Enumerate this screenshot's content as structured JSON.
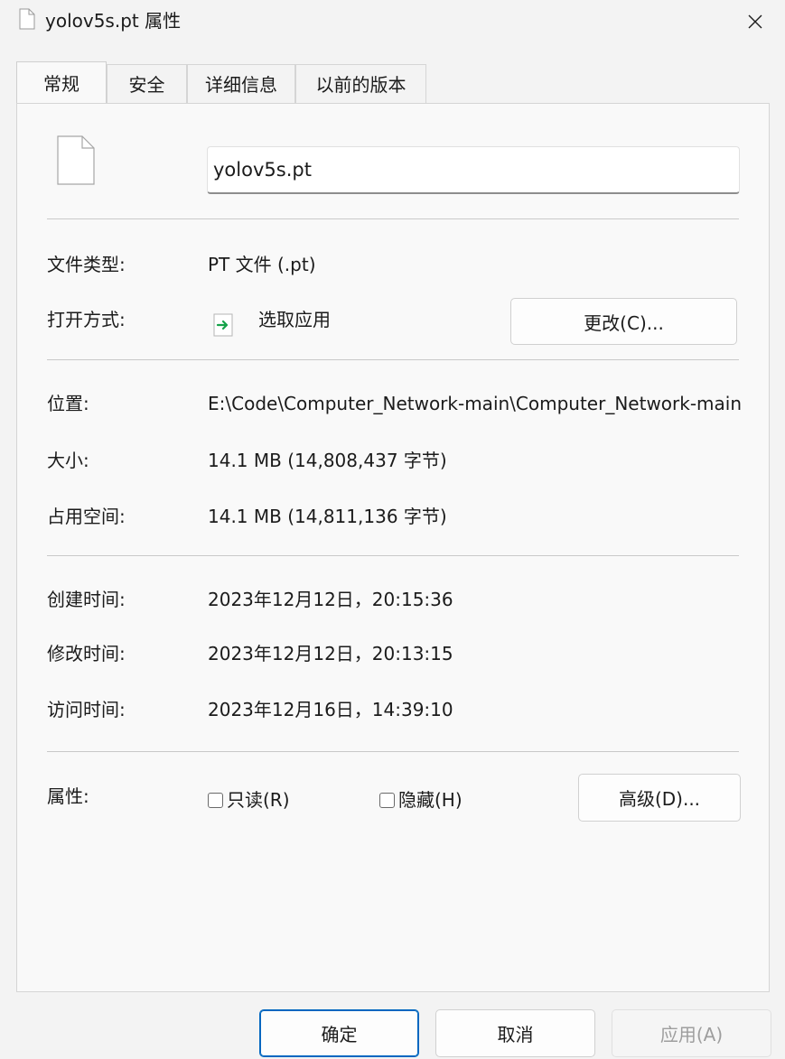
{
  "window": {
    "title": "yolov5s.pt 属性",
    "close_glyph": "✕"
  },
  "tabs": [
    {
      "label": "常规",
      "active": true
    },
    {
      "label": "安全",
      "active": false
    },
    {
      "label": "详细信息",
      "active": false
    },
    {
      "label": "以前的版本",
      "active": false
    }
  ],
  "general": {
    "file_name": "yolov5s.pt",
    "file_type_label": "文件类型:",
    "file_type_value": "PT 文件 (.pt)",
    "open_with_label": "打开方式:",
    "open_with_value": "选取应用",
    "change_button": "更改(C)...",
    "location_label": "位置:",
    "location_value": "E:\\Code\\Computer_Network-main\\Computer_Network-main",
    "size_label": "大小:",
    "size_value": "14.1 MB (14,808,437 字节)",
    "size_on_disk_label": "占用空间:",
    "size_on_disk_value": "14.1 MB (14,811,136 字节)",
    "created_label": "创建时间:",
    "created_value": "2023年12月12日，20:15:36",
    "modified_label": "修改时间:",
    "modified_value": "2023年12月12日，20:13:15",
    "accessed_label": "访问时间:",
    "accessed_value": "2023年12月16日，14:39:10",
    "attributes_label": "属性:",
    "readonly_label": "只读(R)",
    "readonly_checked": false,
    "hidden_label": "隐藏(H)",
    "hidden_checked": false,
    "advanced_button": "高级(D)..."
  },
  "footer": {
    "ok_button": "确定",
    "cancel_button": "取消",
    "apply_button": "应用(A)"
  },
  "icons": {
    "title": "file-icon",
    "close": "close-icon",
    "big_file": "file-icon",
    "app": "pick-app-icon"
  },
  "colors": {
    "accent": "#0067c0",
    "app_icon_arrow": "#16a34a"
  }
}
